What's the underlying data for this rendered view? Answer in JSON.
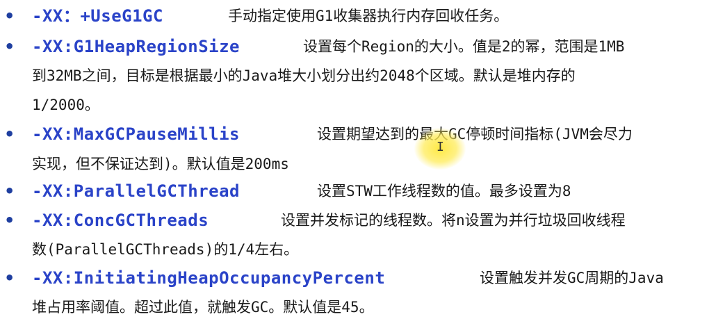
{
  "bullet_glyph": "•",
  "items": [
    {
      "option": "-XX：+UseG1GC",
      "desc": "手动指定使用G1收集器执行内存回收任务。",
      "cont": []
    },
    {
      "option": "-XX:G1HeapRegionSize",
      "desc": "设置每个Region的大小。值是2的幂，范围是1MB",
      "cont": [
        "到32MB之间，目标是根据最小的Java堆大小划分出约2048个区域。默认是堆内存的",
        "1/2000。"
      ]
    },
    {
      "option": "-XX:MaxGCPauseMillis",
      "desc": "设置期望达到的最大GC停顿时间指标(JVM会尽力",
      "cont": [
        "实现，但不保证达到)。默认值是200ms"
      ]
    },
    {
      "option": "-XX:ParallelGCThread",
      "desc": "设置STW工作线程数的值。最多设置为8",
      "cont": []
    },
    {
      "option": "-XX:ConcGCThreads",
      "desc": "设置并发标记的线程数。将n设置为并行垃圾回收线程",
      "cont": [
        "数(ParallelGCThreads)的1/4左右。"
      ]
    },
    {
      "option": "-XX:InitiatingHeapOccupancyPercent",
      "desc": "设置触发并发GC周期的Java",
      "cont": [
        "堆占用率阈值。超过此值，就触发GC。默认值是45。"
      ]
    }
  ],
  "cursor_glyph": "I",
  "colors": {
    "option_blue": "#2a43c8",
    "text": "#1a1a1a",
    "highlight": "#ffe83c"
  }
}
